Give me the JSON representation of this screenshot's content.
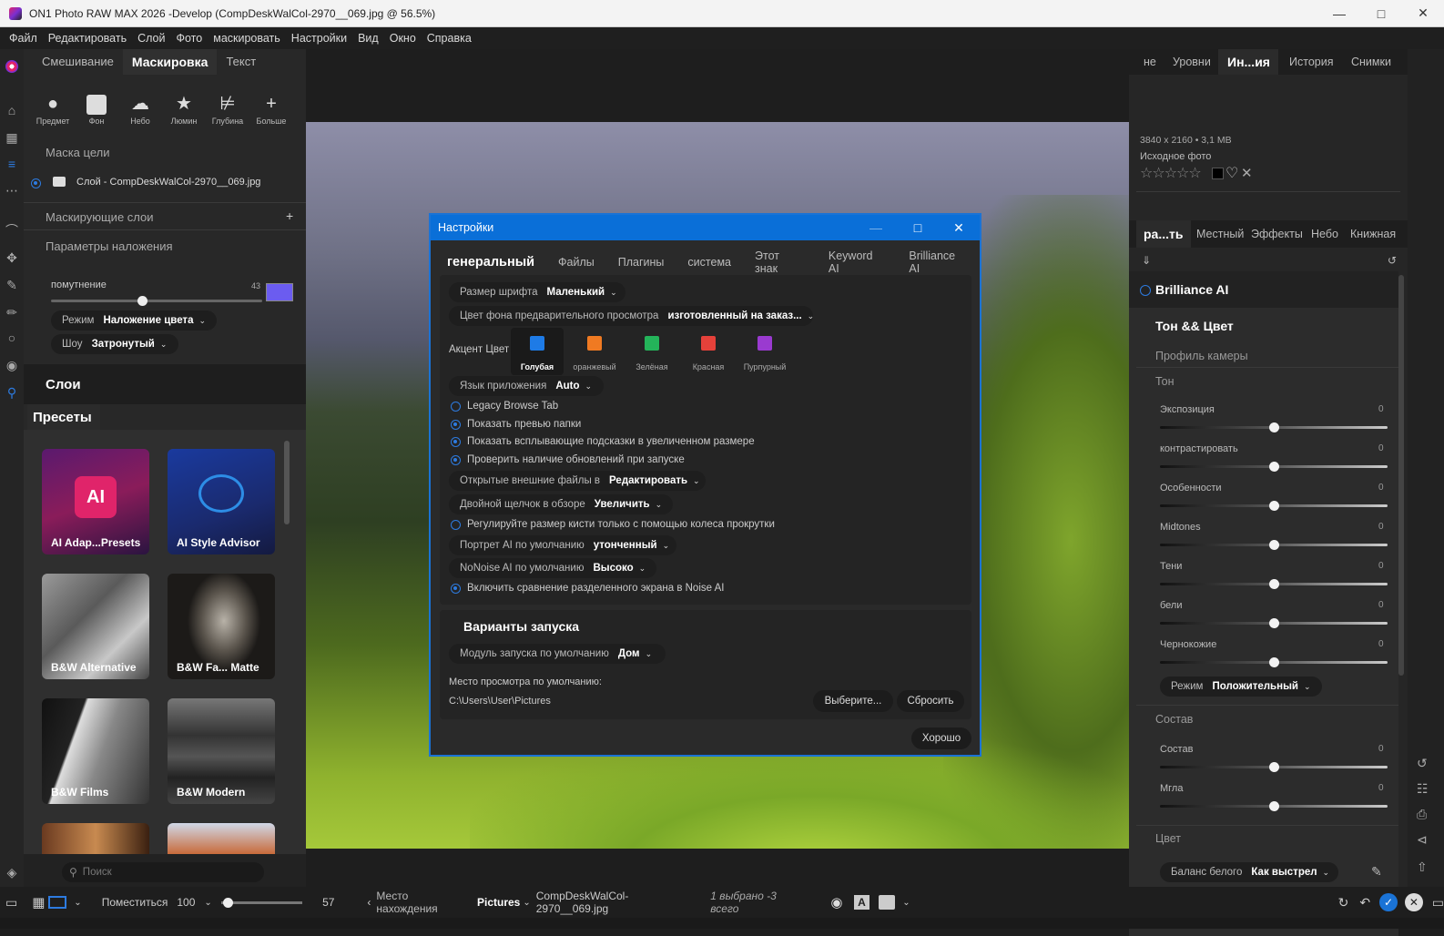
{
  "window": {
    "title": "ON1 Photo RAW MAX 2026 -Develop (CompDeskWalCol-2970__069.jpg @ 56.5%)"
  },
  "menu": [
    "Файл",
    "Редактировать",
    "Слой",
    "Фото",
    "маскировать",
    "Настройки",
    "Вид",
    "Окно",
    "Справка"
  ],
  "left": {
    "tabs": [
      "Смешивание",
      "Маскировка",
      "Текст"
    ],
    "mask_tools": [
      {
        "label": "Предмет",
        "icon": "person-icon"
      },
      {
        "label": "Фон",
        "icon": "background-person-icon"
      },
      {
        "label": "Небо",
        "icon": "sky-cloud-icon"
      },
      {
        "label": "Люмин",
        "icon": "lighthouse-icon"
      },
      {
        "label": "Глубина",
        "icon": "depth-icon"
      },
      {
        "label": "Больше",
        "icon": "plus-icon"
      }
    ],
    "target_mask_label": "Маска цели",
    "layer_name": "Слой - CompDeskWalCol-2970__069.jpg",
    "masking_layers_label": "Маскирующие слои",
    "overlay_params_label": "Параметры наложения",
    "darken_label": "помутнение",
    "darken_value": "43",
    "darken_fraction": 0.43,
    "overlay_color": "#6b5cf0",
    "mode_label": "Режим",
    "mode_value": "Наложение цвета",
    "show_label": "Шоу",
    "show_value": "Затронутый",
    "layers_header": "Слои",
    "presets_header": "Пресеты",
    "presets": [
      {
        "label": "AI Adap...Presets"
      },
      {
        "label": "AI Style Advisor"
      },
      {
        "label": "B&W Alternative"
      },
      {
        "label": "B&W Fa... Matte"
      },
      {
        "label": "B&W Films"
      },
      {
        "label": "B&W Modern"
      }
    ],
    "search_placeholder": "Поиск"
  },
  "dialog": {
    "title": "Настройки",
    "tabs": [
      "генеральный",
      "Файлы",
      "Плагины",
      "система",
      "Этот знак",
      "Keyword AI",
      "Brilliance AI"
    ],
    "font_size_label": "Размер шрифта",
    "font_size_value": "Маленький",
    "preview_bg_label": "Цвет фона предварительного просмотра",
    "preview_bg_value": "изготовленный на заказ...",
    "accent_label": "Акцент Цвет",
    "accents": [
      {
        "label": "Голубая",
        "color": "#1e7be6"
      },
      {
        "label": "оранжевый",
        "color": "#f07a22"
      },
      {
        "label": "Зелёная",
        "color": "#24b45a"
      },
      {
        "label": "Красная",
        "color": "#e5413a"
      },
      {
        "label": "Пурпурный",
        "color": "#9a3ad0"
      }
    ],
    "app_language_label": "Язык приложения",
    "app_language_value": "Auto",
    "opt_legacy": "Legacy Browse Tab",
    "opt_folder_preview": "Показать превью папки",
    "opt_big_tooltips": "Показать всплывающие подсказки в увеличенном размере",
    "opt_check_updates": "Проверить наличие обновлений при запуске",
    "open_external_label": "Открытые внешние файлы в",
    "open_external_value": "Редактировать",
    "double_click_label": "Двойной щелчок в обзоре",
    "double_click_value": "Увеличить",
    "opt_brush_wheel": "Регулируйте размер кисти только с помощью колеса прокрутки",
    "portrait_label": "Портрет AI по умолчанию",
    "portrait_value": "утонченный",
    "nonoise_label": "NoNoise AI по умолчанию",
    "nonoise_value": "Высоко",
    "opt_split_compare": "Включить сравнение разделенного экрана в Noise AI",
    "launch_header": "Варианты запуска",
    "launch_module_label": "Модуль запуска по умолчанию",
    "launch_module_value": "Дом",
    "browse_location_label": "Место просмотра по умолчанию:",
    "browse_location_path": "C:\\Users\\User\\Pictures",
    "choose_btn": "Выберите...",
    "reset_btn": "Сбросить",
    "ok_btn": "Хорошо"
  },
  "right": {
    "top_tabs": [
      "не",
      "Уровни",
      "Ин...ия",
      "История",
      "Снимки"
    ],
    "dimensions": "3840 x 2160 • 3,1 MB",
    "source_label": "Исходное фото",
    "edit_tabs": [
      "ра...ть",
      "Местный",
      "Эффекты",
      "Небо",
      "Книжная"
    ],
    "brilliance": "Brilliance AI",
    "tone_color": "Тон && Цвет",
    "camera_profile": "Профиль камеры",
    "tone_header": "Тон",
    "adjustments": [
      {
        "name": "Экспозиция",
        "value": "0"
      },
      {
        "name": "контрастировать",
        "value": "0"
      },
      {
        "name": "Особенности",
        "value": "0"
      },
      {
        "name": "Midtones",
        "value": "0"
      },
      {
        "name": "Тени",
        "value": "0"
      },
      {
        "name": "бели",
        "value": "0"
      },
      {
        "name": "Чернокожие",
        "value": "0"
      }
    ],
    "mode_label": "Режим",
    "mode_value": "Положительный",
    "composition_header": "Состав",
    "composition_adjustments": [
      {
        "name": "Состав",
        "value": "0"
      },
      {
        "name": "Мгла",
        "value": "0"
      }
    ],
    "color_header": "Цвет",
    "wb_label": "Баланс белого",
    "wb_value": "Как выстрел"
  },
  "bottom": {
    "fit_label": "Поместиться",
    "zoom_value": "100",
    "slider_value": "57",
    "location_label": "Место нахождения",
    "location_value": "Pictures",
    "filename": "CompDeskWalCol-2970__069.jpg",
    "selection_info": "1 выбрано -3 всего"
  }
}
